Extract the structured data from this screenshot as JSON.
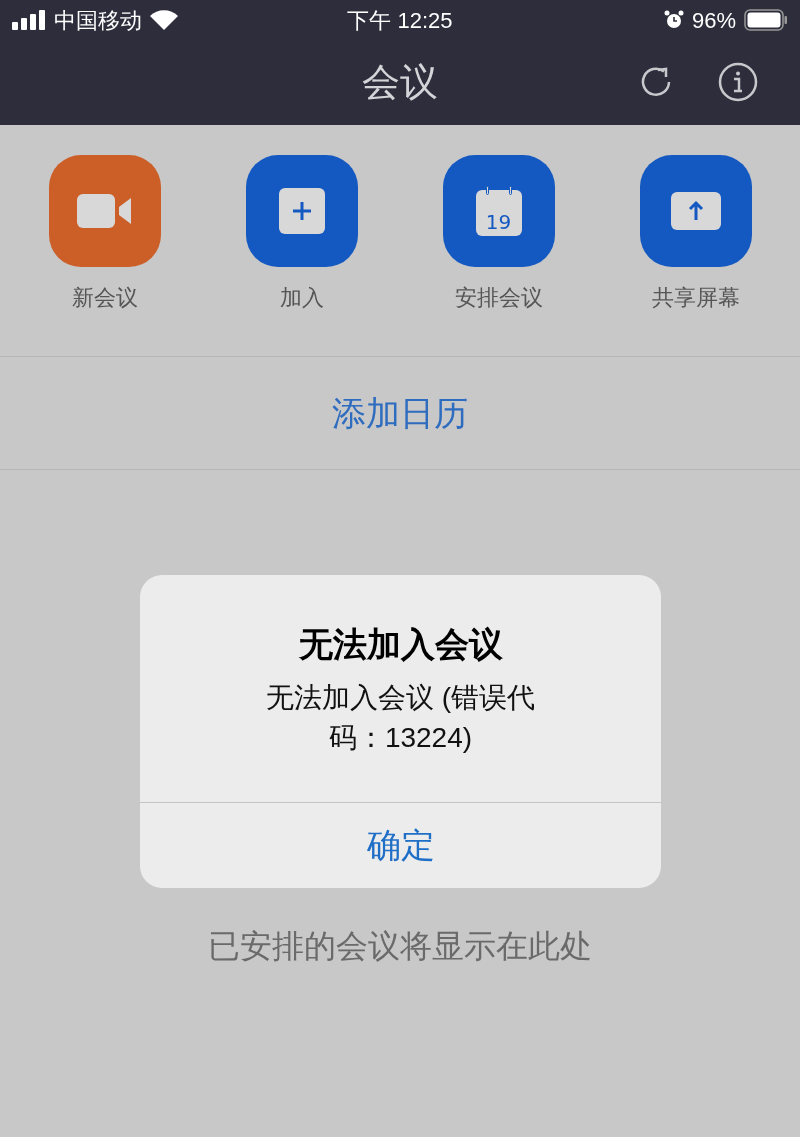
{
  "status_bar": {
    "carrier": "中国移动",
    "time": "下午 12:25",
    "battery": "96%"
  },
  "nav": {
    "title": "会议"
  },
  "actions": [
    {
      "kind": "video",
      "label": "新会议"
    },
    {
      "kind": "plus",
      "label": "加入"
    },
    {
      "kind": "calendar",
      "date": "19",
      "label": "安排会议"
    },
    {
      "kind": "share",
      "label": "共享屏幕"
    }
  ],
  "add_calendar": "添加日历",
  "empty_subtitle": "已安排的会议将显示在此处",
  "dialog": {
    "title": "无法加入会议",
    "message": "无法加入会议 (错误代码：13224)",
    "button": "确定"
  }
}
